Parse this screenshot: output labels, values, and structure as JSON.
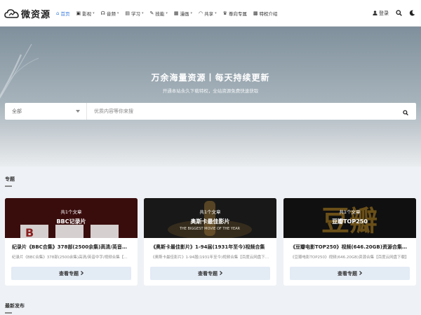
{
  "header": {
    "logo_text": "微资源",
    "nav": [
      {
        "label": "首页",
        "icon": "home-icon",
        "glyph": "⌂",
        "active": true,
        "dropdown": false
      },
      {
        "label": "影视",
        "icon": "film-icon",
        "glyph": "▣",
        "active": false,
        "dropdown": true
      },
      {
        "label": "音频",
        "icon": "headphones-icon",
        "glyph": "☊",
        "active": false,
        "dropdown": true
      },
      {
        "label": "学习",
        "icon": "book-icon",
        "glyph": "▤",
        "active": false,
        "dropdown": true
      },
      {
        "label": "技能",
        "icon": "wrench-icon",
        "glyph": "✎",
        "active": false,
        "dropdown": true
      },
      {
        "label": "漫画",
        "icon": "comic-icon",
        "glyph": "▦",
        "active": false,
        "dropdown": true
      },
      {
        "label": "共享",
        "icon": "wifi-icon",
        "glyph": "◠",
        "active": false,
        "dropdown": true
      },
      {
        "label": "尊向专属",
        "icon": "vip-icon",
        "glyph": "♛",
        "active": false,
        "dropdown": false
      },
      {
        "label": "特权介绍",
        "icon": "badge-icon",
        "glyph": "▩",
        "active": false,
        "dropdown": false
      }
    ],
    "login_label": "登录"
  },
  "hero": {
    "title": "万余海量资源丨每天持续更新",
    "subtitle": "开通本站永久下载特权，全站资源免费快速获取",
    "search": {
      "category": "全部",
      "placeholder": "优质内容等你来搜"
    }
  },
  "sections": {
    "topics_title": "专题",
    "latest_title": "最新发布"
  },
  "topics": [
    {
      "count": "共1个文章",
      "name": "BBC记录片",
      "title": "纪录片《BBC合集》378部(2500余集)高清/英音中字",
      "desc": "纪录片《BBC合集》378部(2500余集)高清/英音中字/视频合集【百度云网盘下载】",
      "button": "查看专题",
      "banner_text": "BBC"
    },
    {
      "count": "共1个文章",
      "name": "奥斯卡最佳影片",
      "title": "《奥斯卡最佳影片》1-94届(1931年至今)视频合集",
      "desc": "《奥斯卡最佳影片》1-94届(1931年至今)视频合集【百度云网盘下载】",
      "button": "查看专题",
      "banner_text": "THE BIGGEST MOVIE OF THE YEAR"
    },
    {
      "count": "共1个文章",
      "name": "豆瓣TOP250",
      "title": "《豆瓣电影TOP250》视频(646.20GB)资源合集【百度云网盘下载】",
      "desc": "《豆瓣电影TOP250》视频(646.20GB)资源合集【百度云网盘下载】",
      "button": "查看专题",
      "banner_text": "豆瓣"
    }
  ],
  "colors": {
    "accent": "#3b7ddd",
    "button_bg": "#e3ebf5"
  }
}
